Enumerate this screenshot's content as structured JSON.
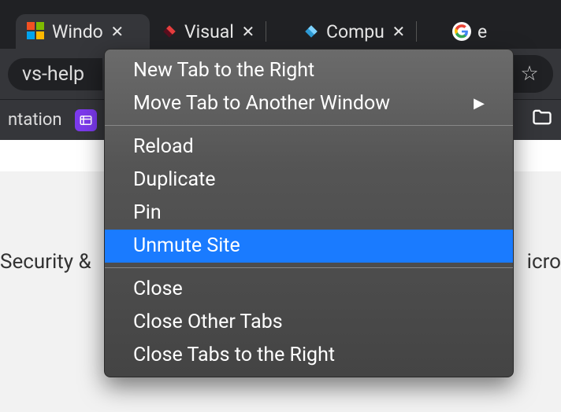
{
  "tabs": [
    {
      "label": "Windo",
      "icon": "microsoft"
    },
    {
      "label": "Visual",
      "icon": "diamond-red-dark"
    },
    {
      "label": "Compu",
      "icon": "diamond-blue"
    },
    {
      "label": "e",
      "icon": "google"
    }
  ],
  "address_fragment": "vs-help",
  "bookmarks": {
    "item_label": "ntation",
    "tile_icon_color": "#7c3aed"
  },
  "page": {
    "left_text": "Security &",
    "right_text": "icro"
  },
  "context_menu": {
    "groups": [
      [
        {
          "label": "New Tab to the Right",
          "submenu": false,
          "highlighted": false
        },
        {
          "label": "Move Tab to Another Window",
          "submenu": true,
          "highlighted": false
        }
      ],
      [
        {
          "label": "Reload",
          "submenu": false,
          "highlighted": false
        },
        {
          "label": "Duplicate",
          "submenu": false,
          "highlighted": false
        },
        {
          "label": "Pin",
          "submenu": false,
          "highlighted": false
        },
        {
          "label": "Unmute Site",
          "submenu": false,
          "highlighted": true
        }
      ],
      [
        {
          "label": "Close",
          "submenu": false,
          "highlighted": false
        },
        {
          "label": "Close Other Tabs",
          "submenu": false,
          "highlighted": false
        },
        {
          "label": "Close Tabs to the Right",
          "submenu": false,
          "highlighted": false
        }
      ]
    ]
  }
}
